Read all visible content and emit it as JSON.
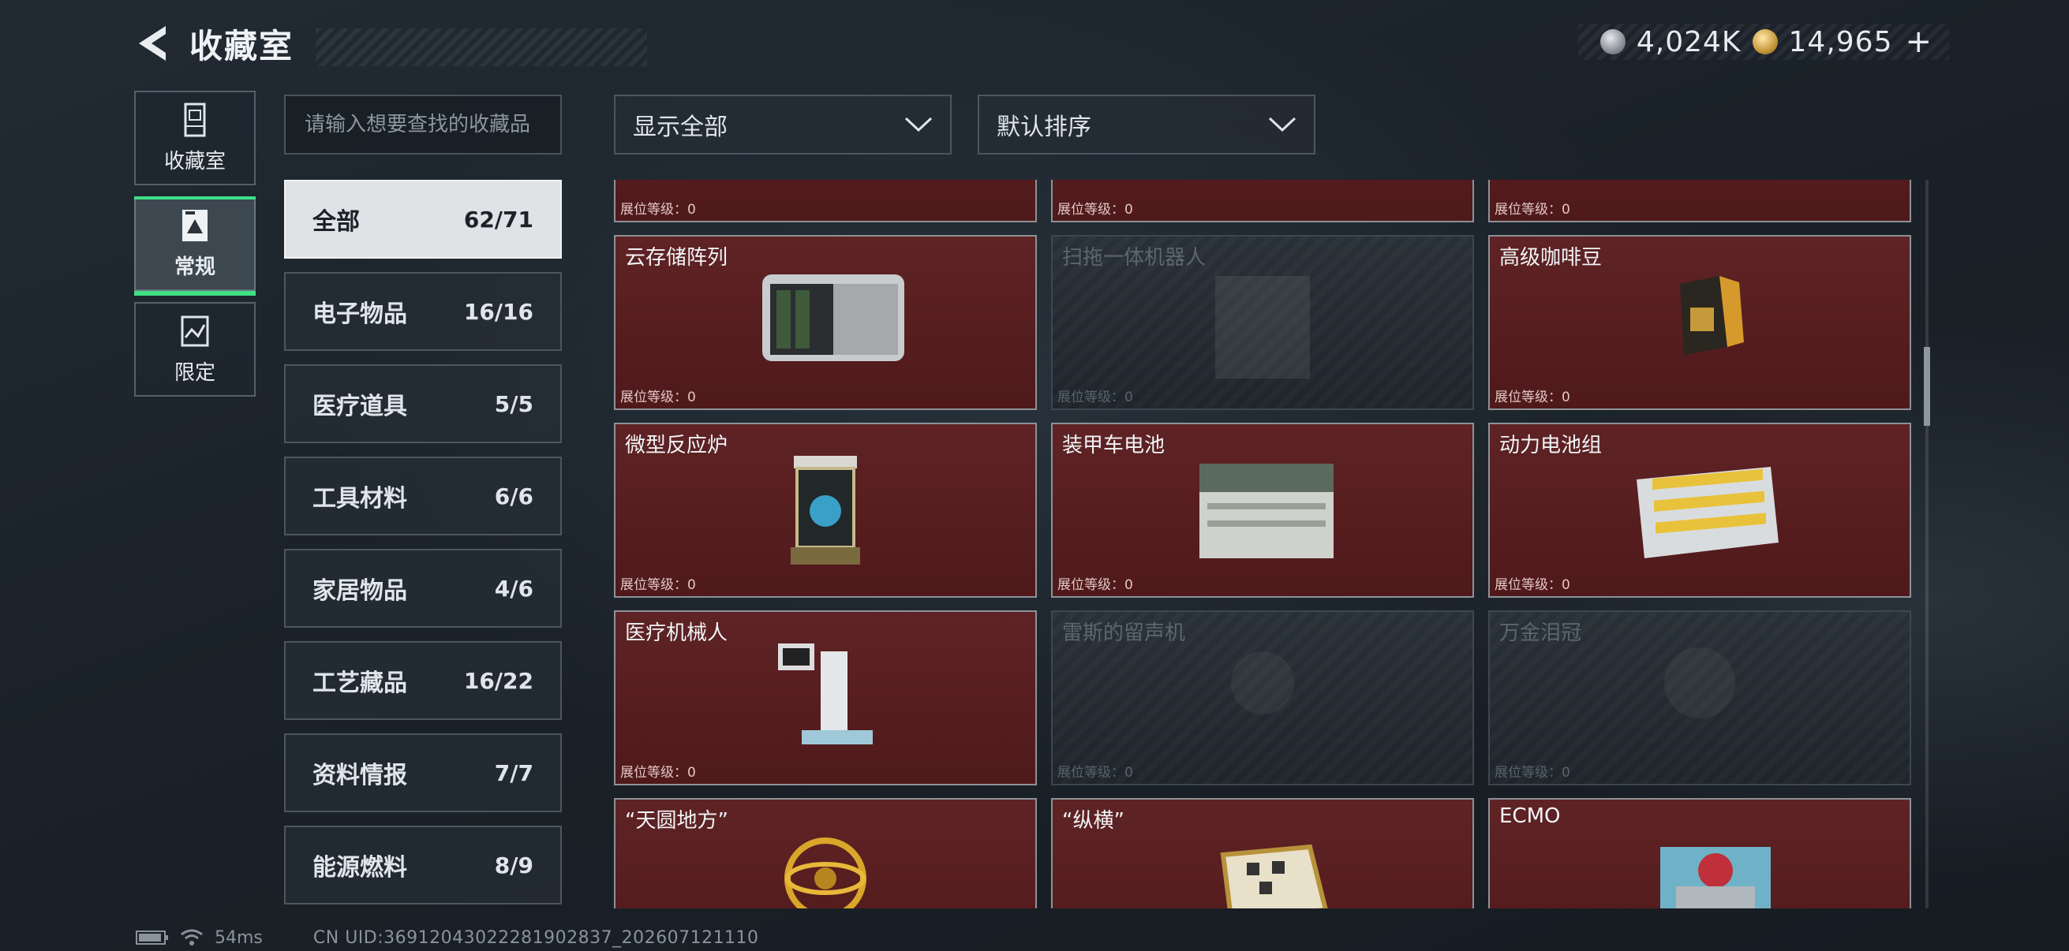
{
  "header": {
    "title": "收藏室"
  },
  "currency": {
    "silver": "4,024K",
    "gold": "14,965",
    "plus": "+"
  },
  "vnav": [
    {
      "label": "收藏室",
      "icon": "trophy-case-icon",
      "active": false
    },
    {
      "label": "常规",
      "icon": "document-icon",
      "active": true
    },
    {
      "label": "限定",
      "icon": "map-icon",
      "active": false
    }
  ],
  "search": {
    "placeholder": "请输入想要查找的收藏品"
  },
  "categories": [
    {
      "label": "全部",
      "count": "62/71",
      "active": true
    },
    {
      "label": "电子物品",
      "count": "16/16"
    },
    {
      "label": "医疗道具",
      "count": "5/5"
    },
    {
      "label": "工具材料",
      "count": "6/6"
    },
    {
      "label": "家居物品",
      "count": "4/6"
    },
    {
      "label": "工艺藏品",
      "count": "16/22"
    },
    {
      "label": "资料情报",
      "count": "7/7"
    },
    {
      "label": "能源燃料",
      "count": "8/9"
    }
  ],
  "filters": {
    "show": "显示全部",
    "sort": "默认排序"
  },
  "level_prefix": "展位等级：",
  "items": [
    {
      "name": "",
      "level": "0",
      "locked": false,
      "icon": "server-box-icon"
    },
    {
      "name": "",
      "level": "0",
      "locked": false,
      "icon": "device-icon"
    },
    {
      "name": "",
      "level": "0",
      "locked": false,
      "icon": "lamp-icon"
    },
    {
      "name": "云存储阵列",
      "level": "0",
      "locked": false,
      "icon": "storage-array-icon"
    },
    {
      "name": "扫拖一体机器人",
      "level": "0",
      "locked": true,
      "icon": "robot-vacuum-icon"
    },
    {
      "name": "高级咖啡豆",
      "level": "0",
      "locked": false,
      "icon": "coffee-bag-icon"
    },
    {
      "name": "微型反应炉",
      "level": "0",
      "locked": false,
      "icon": "reactor-icon"
    },
    {
      "name": "装甲车电池",
      "level": "0",
      "locked": false,
      "icon": "battery-box-icon"
    },
    {
      "name": "动力电池组",
      "level": "0",
      "locked": false,
      "icon": "battery-pack-icon"
    },
    {
      "name": "医疗机械人",
      "level": "0",
      "locked": false,
      "icon": "medical-robot-icon"
    },
    {
      "name": "雷斯的留声机",
      "level": "0",
      "locked": true,
      "icon": "gramophone-icon"
    },
    {
      "name": "万金泪冠",
      "level": "0",
      "locked": true,
      "icon": "crown-icon"
    },
    {
      "name": "“天圆地方”",
      "level": "",
      "locked": false,
      "icon": "armillary-sphere-icon"
    },
    {
      "name": "“纵横”",
      "level": "",
      "locked": false,
      "icon": "chessboard-icon"
    },
    {
      "name": "ECMO",
      "level": "",
      "locked": false,
      "icon": "ecmo-machine-icon"
    }
  ],
  "footer": {
    "ping": "54ms",
    "uid": "CN UID:36912043022281902837_202607121110"
  },
  "colors": {
    "card": "#5a1c1e",
    "accent": "#3fe086",
    "locked": "#222a31"
  }
}
